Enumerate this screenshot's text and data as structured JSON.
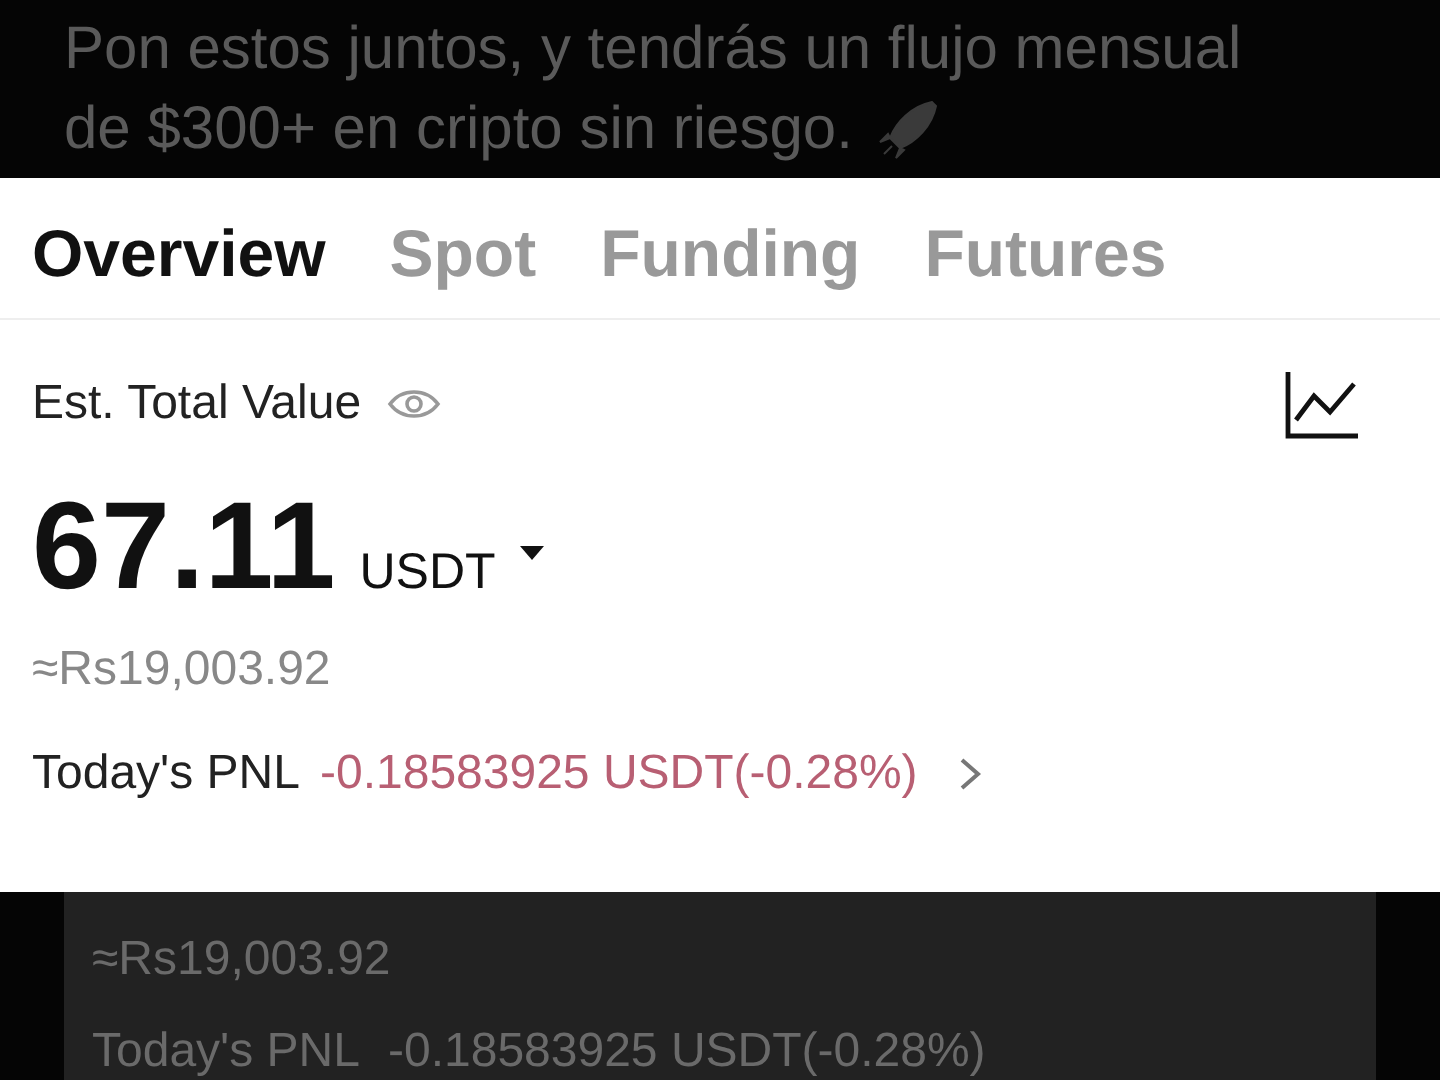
{
  "caption": {
    "lines": [
      "Pon estos juntos, y tendrás un flujo mensual",
      "de $300+ en cripto sin riesgo."
    ]
  },
  "tabs": [
    {
      "label": "Overview",
      "selected": true
    },
    {
      "label": "Spot",
      "selected": false
    },
    {
      "label": "Funding",
      "selected": false
    },
    {
      "label": "Futures",
      "selected": false
    }
  ],
  "balance": {
    "label": "Est. Total Value",
    "amount": "67.11",
    "currency": "USDT",
    "fiat": "≈Rs19,003.92"
  },
  "pnl": {
    "label": "Today's PNL",
    "value": "-0.18583925 USDT(-0.28%)"
  },
  "echo": {
    "fiat": "≈Rs19,003.92",
    "pnl_label": "Today's PNL",
    "pnl_value": "-0.18583925 USDT(-0.28%)"
  }
}
